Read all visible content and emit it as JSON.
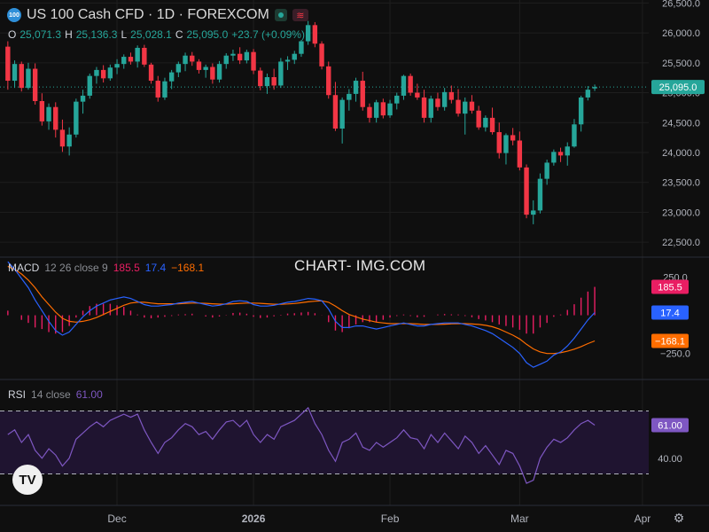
{
  "header": {
    "symbol_icon_text": "100",
    "title": "US 100 Cash CFD · 1D · FOREXCOM",
    "badge_icon": "market-open-dot",
    "badge2_icon": "wave-icon",
    "badge2_glyph": "≋"
  },
  "ohlc": {
    "o_label": "O",
    "o_value": "25,071.3",
    "h_label": "H",
    "h_value": "25,136.3",
    "l_label": "L",
    "l_value": "25,028.1",
    "c_label": "C",
    "c_value": "25,095.0",
    "change": "+23.7 (+0.09%)"
  },
  "macd_legend": {
    "name": "MACD",
    "params": "12 26 close 9",
    "hist": "185.5",
    "macd": "17.4",
    "signal": "−168.1"
  },
  "rsi_legend": {
    "name": "RSI",
    "params": "14 close",
    "value": "61.00"
  },
  "watermark": "CHART- IMG.COM",
  "logo_text": "TV",
  "colors": {
    "background": "#0f0f0f",
    "up": "#26a69a",
    "down": "#f23645",
    "macd_line": "#2962ff",
    "signal_line": "#ff6d00",
    "histogram": "#e91e63",
    "rsi_line": "#7e57c2",
    "rsi_band": "#1f1430",
    "grid": "#1e1e1e"
  },
  "chart_data": [
    {
      "type": "candlestick",
      "title": "US 100 Cash CFD · 1D · FOREXCOM",
      "ylim": [
        22250,
        26550
      ],
      "y_ticks": [
        "26,500.0",
        "26,000.0",
        "25,500.0",
        "25,000.0",
        "24,500.0",
        "24,000.0",
        "23,500.0",
        "23,000.0",
        "22,500.0"
      ],
      "y_tick_values": [
        26500,
        26000,
        25500,
        25000,
        24500,
        24000,
        23500,
        23000,
        22500
      ],
      "x_labels": [
        "Dec",
        "2026",
        "Feb",
        "Mar",
        "Apr"
      ],
      "x_label_index": [
        16,
        36,
        56,
        75,
        93
      ],
      "last_price": 25095.0,
      "last_price_label": "25,095.0",
      "candles": [
        [
          25770,
          25860,
          25050,
          25200
        ],
        [
          25200,
          25540,
          25080,
          25480
        ],
        [
          25480,
          25520,
          25020,
          25080
        ],
        [
          25080,
          25500,
          25050,
          25400
        ],
        [
          25400,
          25490,
          24800,
          24860
        ],
        [
          24860,
          24990,
          24450,
          24520
        ],
        [
          24520,
          24820,
          24380,
          24760
        ],
        [
          24760,
          24840,
          24250,
          24380
        ],
        [
          24380,
          24550,
          24010,
          24100
        ],
        [
          24100,
          24420,
          23950,
          24300
        ],
        [
          24300,
          24900,
          24250,
          24850
        ],
        [
          24850,
          25050,
          24650,
          24950
        ],
        [
          24950,
          25320,
          24900,
          25280
        ],
        [
          25280,
          25430,
          25150,
          25380
        ],
        [
          25380,
          25460,
          25170,
          25240
        ],
        [
          25240,
          25470,
          25200,
          25420
        ],
        [
          25420,
          25560,
          25310,
          25480
        ],
        [
          25480,
          25640,
          25400,
          25600
        ],
        [
          25600,
          25670,
          25470,
          25520
        ],
        [
          25520,
          25790,
          25420,
          25750
        ],
        [
          25750,
          25800,
          25430,
          25470
        ],
        [
          25470,
          25500,
          25150,
          25200
        ],
        [
          25200,
          25280,
          24850,
          24920
        ],
        [
          24920,
          25250,
          24880,
          25190
        ],
        [
          25190,
          25380,
          25060,
          25340
        ],
        [
          25340,
          25520,
          25260,
          25480
        ],
        [
          25480,
          25670,
          25360,
          25620
        ],
        [
          25620,
          25680,
          25450,
          25520
        ],
        [
          25520,
          25560,
          25320,
          25380
        ],
        [
          25380,
          25470,
          25250,
          25430
        ],
        [
          25430,
          25490,
          25150,
          25220
        ],
        [
          25220,
          25530,
          25170,
          25480
        ],
        [
          25480,
          25660,
          25400,
          25620
        ],
        [
          25620,
          25720,
          25530,
          25650
        ],
        [
          25650,
          25760,
          25480,
          25540
        ],
        [
          25540,
          25720,
          25490,
          25680
        ],
        [
          25680,
          25730,
          25310,
          25370
        ],
        [
          25370,
          25420,
          25040,
          25110
        ],
        [
          25110,
          25320,
          24980,
          25260
        ],
        [
          25260,
          25400,
          25050,
          25120
        ],
        [
          25120,
          25580,
          25080,
          25520
        ],
        [
          25520,
          25610,
          25380,
          25550
        ],
        [
          25550,
          25700,
          25480,
          25650
        ],
        [
          25650,
          25880,
          25600,
          25860
        ],
        [
          25860,
          26200,
          25800,
          26130
        ],
        [
          26130,
          26180,
          25760,
          25820
        ],
        [
          25820,
          25860,
          25390,
          25440
        ],
        [
          25440,
          25520,
          24900,
          24960
        ],
        [
          24960,
          25180,
          24360,
          24400
        ],
        [
          24400,
          24920,
          24150,
          24880
        ],
        [
          24880,
          25060,
          24700,
          24980
        ],
        [
          24980,
          25250,
          24850,
          25200
        ],
        [
          25200,
          25350,
          24700,
          24760
        ],
        [
          24760,
          24820,
          24500,
          24580
        ],
        [
          24580,
          24880,
          24500,
          24840
        ],
        [
          24840,
          24900,
          24570,
          24620
        ],
        [
          24620,
          24880,
          24580,
          24820
        ],
        [
          24820,
          25000,
          24720,
          24950
        ],
        [
          24950,
          25300,
          24880,
          25280
        ],
        [
          25280,
          25320,
          24950,
          25000
        ],
        [
          25000,
          25150,
          24880,
          24920
        ],
        [
          24920,
          25050,
          24500,
          24580
        ],
        [
          24580,
          24950,
          24500,
          24900
        ],
        [
          24900,
          25000,
          24700,
          24760
        ],
        [
          24760,
          25080,
          24700,
          25010
        ],
        [
          25010,
          25120,
          24820,
          24880
        ],
        [
          24880,
          25060,
          24600,
          24650
        ],
        [
          24650,
          24920,
          24300,
          24850
        ],
        [
          24850,
          24960,
          24650,
          24700
        ],
        [
          24700,
          24780,
          24380,
          24420
        ],
        [
          24420,
          24620,
          24350,
          24580
        ],
        [
          24580,
          24750,
          24300,
          24340
        ],
        [
          24340,
          24500,
          23900,
          23990
        ],
        [
          23990,
          24320,
          23800,
          24290
        ],
        [
          24290,
          24410,
          24120,
          24200
        ],
        [
          24200,
          24350,
          23700,
          23750
        ],
        [
          23750,
          23800,
          22900,
          22960
        ],
        [
          22960,
          23200,
          22800,
          23030
        ],
        [
          23030,
          23650,
          22980,
          23560
        ],
        [
          23560,
          23880,
          23460,
          23830
        ],
        [
          23830,
          24050,
          23780,
          24010
        ],
        [
          24010,
          24080,
          23840,
          23950
        ],
        [
          23950,
          24170,
          23780,
          24100
        ],
        [
          24100,
          24560,
          24080,
          24470
        ],
        [
          24470,
          24950,
          24350,
          24920
        ],
        [
          24920,
          25110,
          24870,
          25050
        ],
        [
          25071.3,
          25136.3,
          25028.1,
          25095.0
        ]
      ]
    },
    {
      "type": "line",
      "title": "MACD 12 26 close 9",
      "ylim": [
        -420,
        380
      ],
      "y_ticks": [
        "250.0",
        "−250.0"
      ],
      "y_tick_values": [
        250,
        -250
      ],
      "last_values": {
        "histogram": 185.5,
        "macd": 17.4,
        "signal": -168.1
      },
      "series": [
        {
          "name": "MACD",
          "values": [
            350,
            300,
            240,
            180,
            100,
            30,
            -40,
            -100,
            -130,
            -110,
            -60,
            -10,
            30,
            60,
            80,
            100,
            110,
            120,
            110,
            90,
            70,
            60,
            60,
            65,
            70,
            80,
            85,
            90,
            80,
            70,
            60,
            65,
            75,
            90,
            95,
            90,
            70,
            60,
            60,
            65,
            75,
            85,
            90,
            100,
            110,
            105,
            95,
            40,
            -40,
            -80,
            -80,
            -70,
            -70,
            -80,
            -90,
            -80,
            -70,
            -60,
            -50,
            -60,
            -70,
            -70,
            -60,
            -55,
            -50,
            -50,
            -50,
            -60,
            -70,
            -85,
            -100,
            -120,
            -150,
            -180,
            -210,
            -250,
            -310,
            -340,
            -320,
            -300,
            -260,
            -240,
            -200,
            -150,
            -90,
            -30,
            17.4
          ]
        },
        {
          "name": "Signal",
          "values": [
            320,
            300,
            270,
            230,
            180,
            120,
            70,
            20,
            -20,
            -40,
            -45,
            -40,
            -30,
            -15,
            5,
            25,
            45,
            65,
            80,
            85,
            85,
            80,
            75,
            75,
            75,
            75,
            78,
            80,
            80,
            78,
            75,
            73,
            73,
            75,
            78,
            80,
            80,
            78,
            75,
            72,
            72,
            74,
            77,
            82,
            88,
            92,
            94,
            85,
            60,
            30,
            5,
            -10,
            -25,
            -35,
            -45,
            -50,
            -55,
            -55,
            -55,
            -55,
            -57,
            -60,
            -60,
            -60,
            -58,
            -56,
            -55,
            -55,
            -57,
            -60,
            -66,
            -75,
            -90,
            -110,
            -130,
            -155,
            -190,
            -220,
            -240,
            -250,
            -250,
            -245,
            -235,
            -222,
            -205,
            -185,
            -168.1
          ]
        },
        {
          "name": "Histogram",
          "values": [
            30,
            0,
            -30,
            -50,
            -80,
            -90,
            -110,
            -120,
            -110,
            -70,
            -15,
            30,
            60,
            75,
            75,
            75,
            65,
            55,
            30,
            5,
            -15,
            -20,
            -15,
            -10,
            -5,
            5,
            7,
            10,
            0,
            -8,
            -15,
            -8,
            2,
            15,
            17,
            10,
            -10,
            -18,
            -15,
            -7,
            3,
            11,
            13,
            18,
            22,
            13,
            1,
            -45,
            -100,
            -110,
            -85,
            -60,
            -45,
            -45,
            -45,
            -30,
            -15,
            -5,
            5,
            -5,
            -13,
            -10,
            0,
            5,
            8,
            6,
            5,
            -5,
            -13,
            -25,
            -34,
            -45,
            -60,
            -70,
            -80,
            -95,
            -120,
            -120,
            -80,
            -50,
            -10,
            5,
            35,
            72,
            115,
            155,
            185.5
          ]
        }
      ]
    },
    {
      "type": "line",
      "title": "RSI 14 close",
      "ylim": [
        10,
        90
      ],
      "band": [
        30,
        70
      ],
      "y_ticks": [
        "40.00"
      ],
      "y_tick_values": [
        40
      ],
      "last_value": 61.0,
      "series": [
        {
          "name": "RSI",
          "values": [
            55,
            58,
            50,
            55,
            45,
            40,
            46,
            42,
            35,
            40,
            52,
            56,
            60,
            63,
            60,
            64,
            66,
            68,
            66,
            68,
            58,
            50,
            43,
            50,
            53,
            58,
            62,
            60,
            55,
            57,
            52,
            58,
            63,
            64,
            60,
            64,
            55,
            50,
            55,
            52,
            60,
            62,
            64,
            68,
            72,
            62,
            55,
            45,
            38,
            50,
            52,
            56,
            47,
            45,
            50,
            47,
            50,
            53,
            58,
            53,
            52,
            46,
            55,
            50,
            56,
            51,
            46,
            54,
            50,
            43,
            48,
            42,
            36,
            45,
            43,
            35,
            24,
            26,
            40,
            47,
            52,
            50,
            53,
            58,
            62,
            64,
            61
          ]
        }
      ]
    }
  ]
}
